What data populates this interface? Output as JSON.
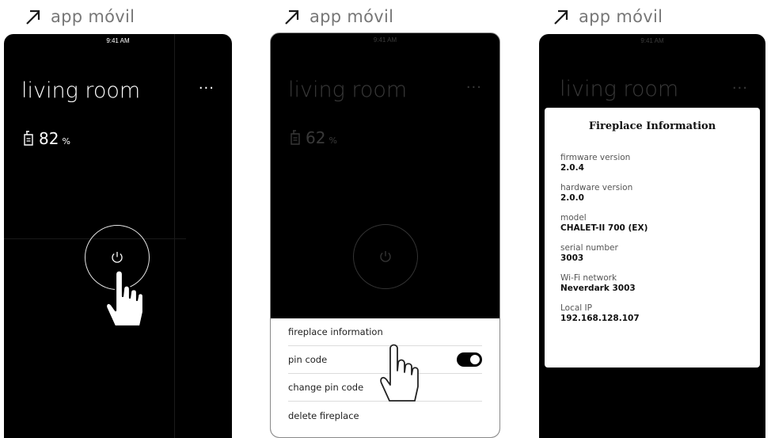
{
  "panels": [
    {
      "heading": "app móvil"
    },
    {
      "heading": "app móvil"
    },
    {
      "heading": "app móvil"
    }
  ],
  "status_bar": {
    "time": "9:41 AM"
  },
  "screen1": {
    "room_title": "living room",
    "more": "···",
    "level_value": "82",
    "level_unit": "%"
  },
  "screen2": {
    "room_title": "living room",
    "more": "···",
    "level_value": "62",
    "level_unit": "%",
    "menu": [
      {
        "label": "fireplace information"
      },
      {
        "label": "pin code",
        "toggle_on": true
      },
      {
        "label": "change pin code"
      },
      {
        "label": "delete fireplace"
      }
    ]
  },
  "screen3": {
    "room_title": "living room",
    "more": "···",
    "card_title": "Fireplace Information",
    "fields": [
      {
        "label": "firmware version",
        "value": "2.0.4"
      },
      {
        "label": "hardware version",
        "value": "2.0.0"
      },
      {
        "label": "model",
        "value": "CHALET-II 700 (EX)"
      },
      {
        "label": "serial number",
        "value": "3003"
      },
      {
        "label": "Wi-Fi network",
        "value": "Neverdark 3003"
      },
      {
        "label": "Local IP",
        "value": "192.168.128.107"
      }
    ]
  },
  "colors": {
    "screen_bg": "#000000",
    "heading": "#777777",
    "accent": "#ffffff"
  }
}
